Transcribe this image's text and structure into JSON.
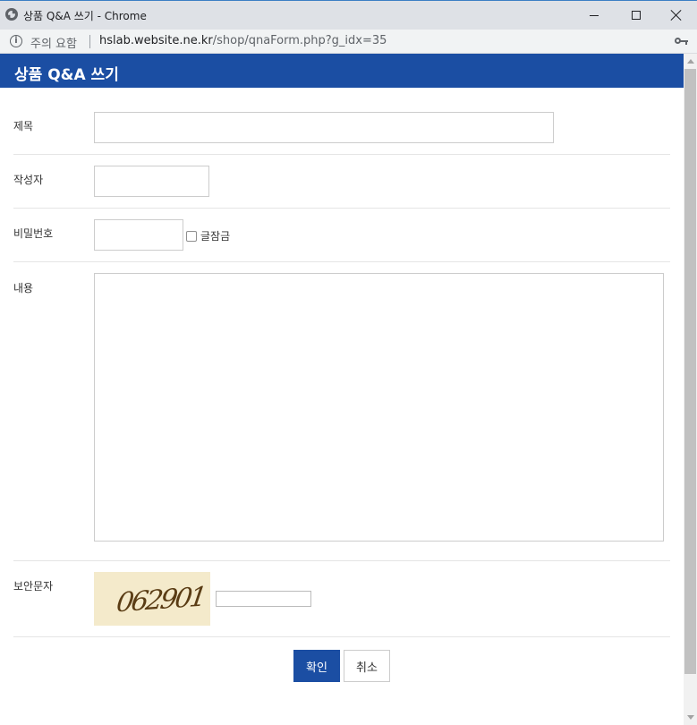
{
  "window": {
    "title": "상품 Q&A 쓰기 - Chrome",
    "site_icon": "globe-icon"
  },
  "address_bar": {
    "security_text": "주의 요함",
    "url_host": "hslab.website.ne.kr",
    "url_path": "/shop/qnaForm.php?g_idx=35",
    "key_icon": "key-icon"
  },
  "page": {
    "title": "상품 Q&A 쓰기"
  },
  "form": {
    "subject_label": "제목",
    "writer_label": "작성자",
    "password_label": "비밀번호",
    "secret_label": "글잠금",
    "content_label": "내용",
    "captcha_label": "보안문자",
    "captcha_code": "062901"
  },
  "buttons": {
    "confirm": "확인",
    "cancel": "취소"
  },
  "colors": {
    "header": "#1b4ea3",
    "primary_button": "#1b4ea3",
    "captcha_bg": "#f4eacb"
  }
}
